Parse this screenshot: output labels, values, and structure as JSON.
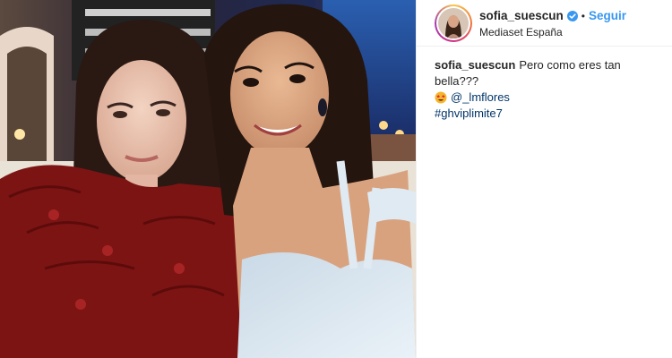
{
  "post": {
    "account": {
      "username": "sofia_suescun",
      "verified": true,
      "separator": "•",
      "follow_label": "Seguir",
      "location": "Mediaset España"
    },
    "caption": {
      "username": "sofia_suescun",
      "text": "Pero como eres tan bella???",
      "emoji": "star-struck-emoji",
      "mention": "@_lmflores",
      "hashtag": "#ghviplimite7"
    },
    "colors": {
      "link_blue": "#3897f0",
      "hashtag_navy": "#003569",
      "text": "#262626",
      "border": "#efefef"
    }
  }
}
